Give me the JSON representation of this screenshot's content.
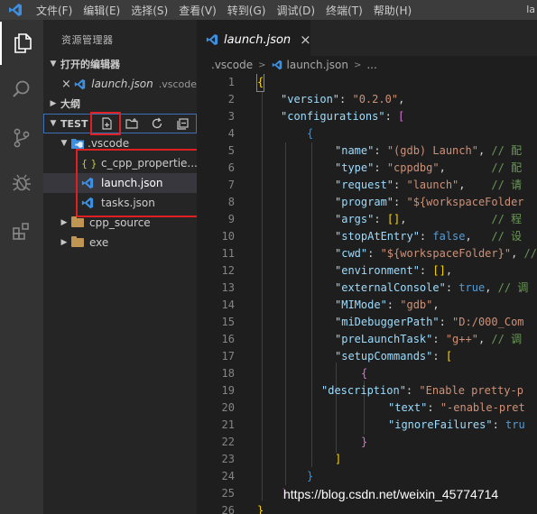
{
  "window": {
    "title_fragment": "la",
    "menu": [
      "文件(F)",
      "编辑(E)",
      "选择(S)",
      "查看(V)",
      "转到(G)",
      "调试(D)",
      "终端(T)",
      "帮助(H)"
    ]
  },
  "activity_bar": [
    {
      "icon": "files-icon",
      "active": true
    },
    {
      "icon": "search-icon",
      "active": false
    },
    {
      "icon": "source-control-icon",
      "active": false
    },
    {
      "icon": "debug-icon",
      "active": false
    },
    {
      "icon": "extensions-icon",
      "active": false
    }
  ],
  "sidebar": {
    "title": "资源管理器",
    "open_editors": {
      "header": "打开的编辑器",
      "items": [
        {
          "close": "×",
          "name": "launch.json",
          "folder": ".vscode"
        }
      ]
    },
    "outline": {
      "header": "大纲"
    },
    "workspace": {
      "header": "TEST",
      "actions": [
        "new-file-icon",
        "new-folder-icon",
        "refresh-icon",
        "collapse-all-icon"
      ]
    },
    "tree": [
      {
        "name": ".vscode",
        "kind": "folder",
        "expanded": true
      },
      {
        "name": "c_cpp_properties.json",
        "display": "c_cpp_propertie...",
        "kind": "json-curly"
      },
      {
        "name": "launch.json",
        "kind": "vscode-json",
        "selected": true
      },
      {
        "name": "tasks.json",
        "kind": "vscode-json"
      },
      {
        "name": "cpp_source",
        "kind": "folder",
        "expanded": false
      },
      {
        "name": "exe",
        "kind": "folder",
        "expanded": false
      }
    ]
  },
  "editor": {
    "tab": {
      "label": "launch.json",
      "close": "×"
    },
    "breadcrumb": [
      ".vscode",
      "launch.json",
      "..."
    ],
    "line_numbers": [
      "1",
      "2",
      "3",
      "4",
      "5",
      "6",
      "7",
      "8",
      "9",
      "10",
      "11",
      "12",
      "13",
      "14",
      "15",
      "16",
      "17",
      "18",
      "19",
      "20",
      "21",
      "22",
      "23",
      "24",
      "25",
      "26"
    ],
    "code": {
      "l1_brace": "{",
      "l2_key": "\"version\"",
      "l2_val": "\"0.2.0\"",
      "l3_key": "\"configurations\"",
      "l3_br": "[",
      "l4_brace": "{",
      "l5_key": "\"name\"",
      "l5_val": "\"(gdb) Launch\"",
      "l5_cmt": "// 配",
      "l6_key": "\"type\"",
      "l6_val": "\"cppdbg\"",
      "l6_cmt": "// 配",
      "l7_key": "\"request\"",
      "l7_val": "\"launch\"",
      "l7_cmt": "// 请",
      "l8_key": "\"program\"",
      "l8_val": "\"${workspaceFolder",
      "l9_key": "\"args\"",
      "l9_val": "[]",
      "l9_cmt": "// 程",
      "l10_key": "\"stopAtEntry\"",
      "l10_val": "false",
      "l10_cmt": "// 设",
      "l11_key": "\"cwd\"",
      "l11_val": "\"${workspaceFolder}\"",
      "l11_cmt": "//",
      "l12_key": "\"environment\"",
      "l12_val": "[]",
      "l13_key": "\"externalConsole\"",
      "l13_val": "true",
      "l13_cmt": "// 调",
      "l14_key": "\"MIMode\"",
      "l14_val": "\"gdb\"",
      "l15_key": "\"miDebuggerPath\"",
      "l15_val": "\"D:/000_Com",
      "l16_key": "\"preLaunchTask\"",
      "l16_val": "\"g++\"",
      "l16_cmt": "// 调",
      "l17_key": "\"setupCommands\"",
      "l17_br": "[",
      "l18_brace": "{",
      "l19_key": "\"description\"",
      "l19_val": "\"Enable pretty-p",
      "l20_key": "\"text\"",
      "l20_val": "\"-enable-pret",
      "l21_key": "\"ignoreFailures\"",
      "l21_val": "tru",
      "l22_brace": "}",
      "l23_br": "]",
      "l24_brace": "}",
      "l25_br": "]",
      "l26_brace": "}"
    }
  },
  "watermark": "https://blog.csdn.net/weixin_45774714",
  "colors": {
    "annotation_box": "#e02020",
    "vscode_blue": "#3e8fe0",
    "folder": "#c09553"
  }
}
